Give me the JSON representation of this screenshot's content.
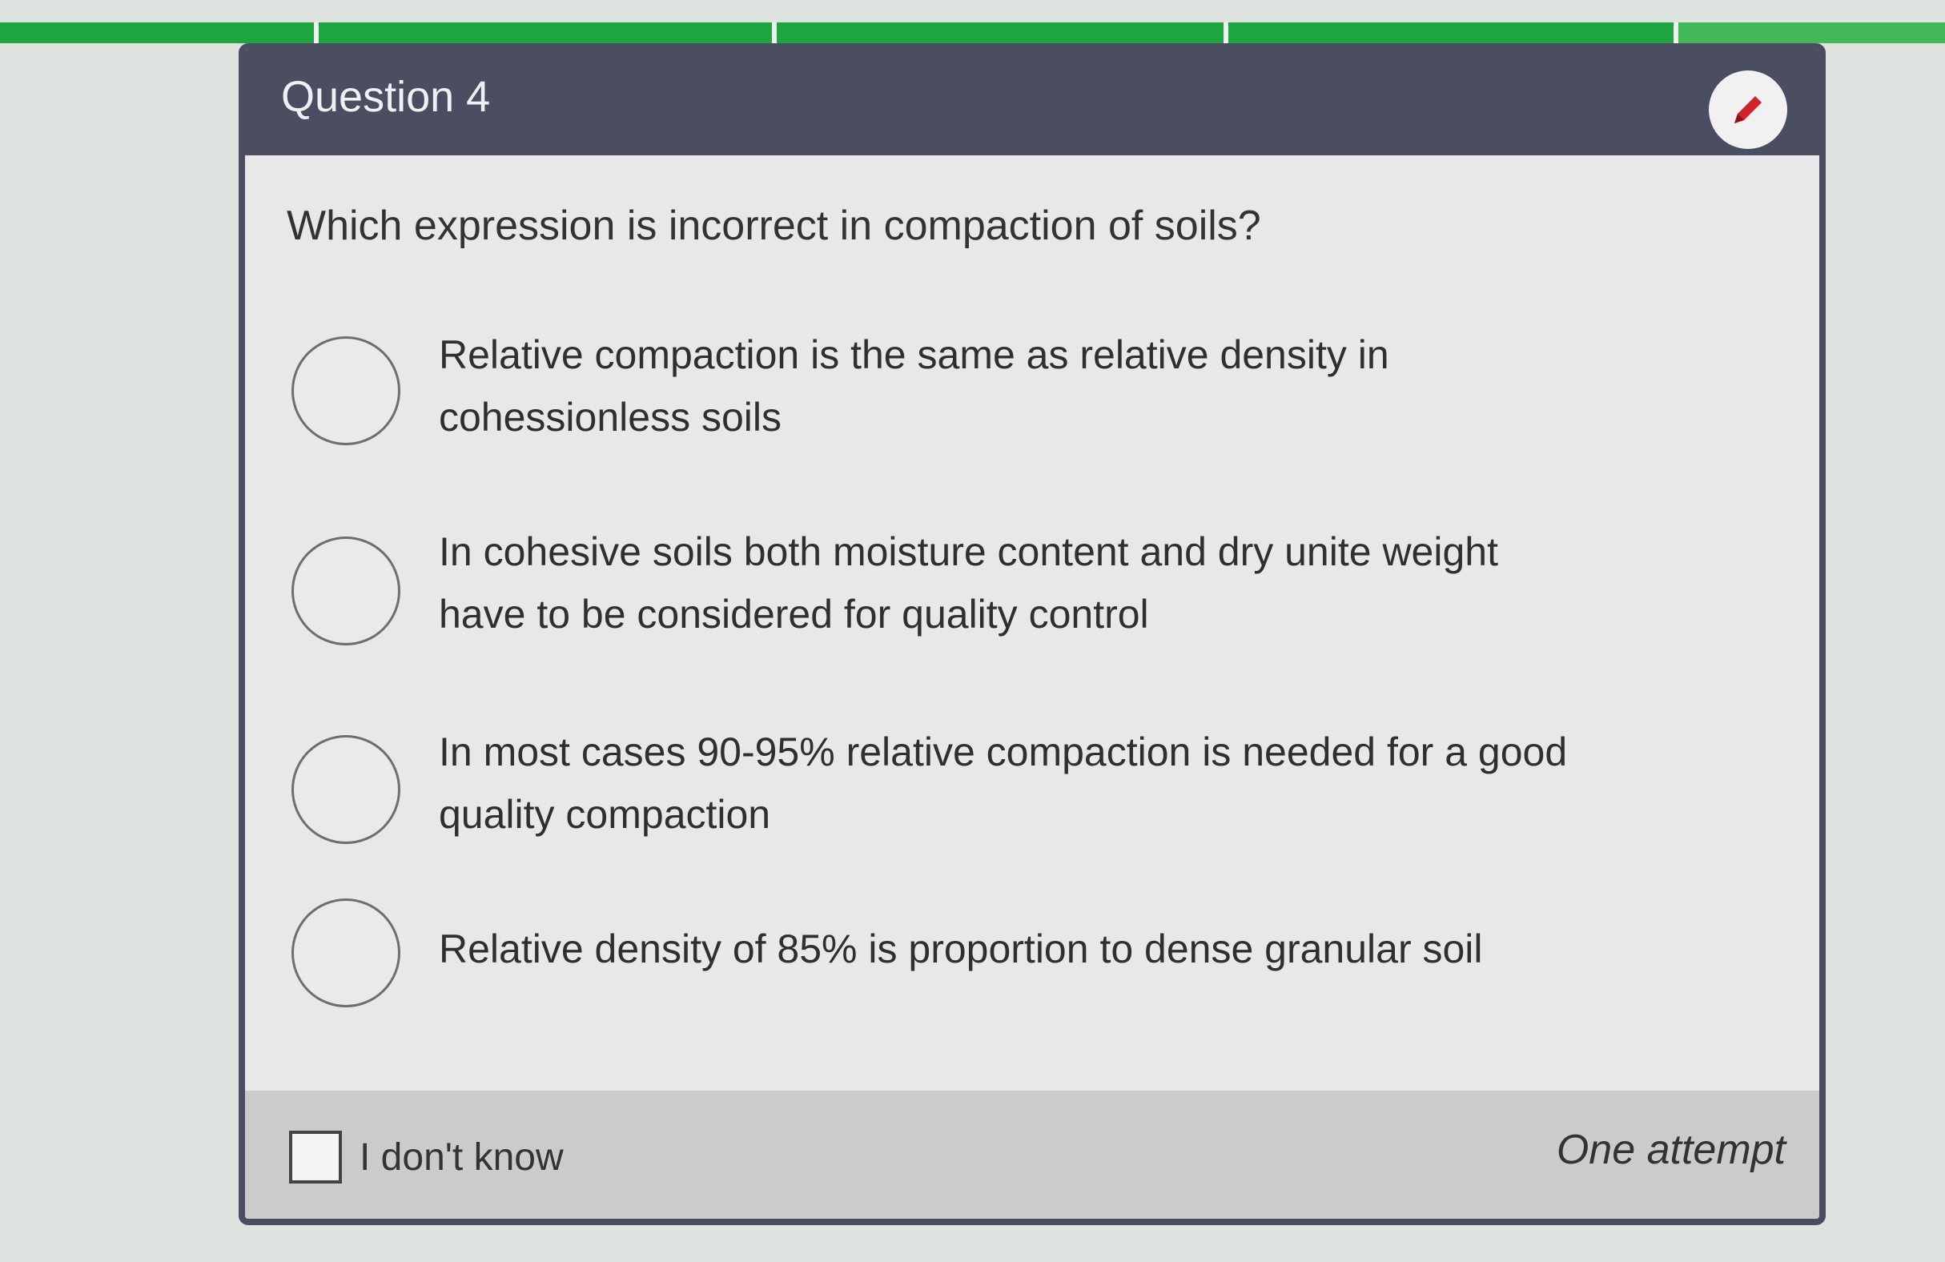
{
  "colors": {
    "progress": "#1fa53f",
    "header": "#4b4e60",
    "edit_icon": "#d2232a",
    "card_bg": "#e6e9e7"
  },
  "progress_segments": 4,
  "question": {
    "title": "Question 4",
    "text": "Which expression is incorrect in compaction of soils?",
    "edit_icon": "pencil-icon"
  },
  "options": [
    {
      "line1": "Relative compaction is the same as relative density in",
      "line2": "cohessionless soils"
    },
    {
      "line1": "In cohesive soils both moisture content and dry unite weight",
      "line2": "have to be considered for quality control"
    },
    {
      "line1": "In most cases 90-95% relative compaction is needed for a good",
      "line2": "quality compaction"
    },
    {
      "line1": "Relative density of 85% is proportion to dense granular soil",
      "line2": ""
    }
  ],
  "footer": {
    "dont_know_label": "I don't know",
    "attempts_label": "One attempt"
  }
}
